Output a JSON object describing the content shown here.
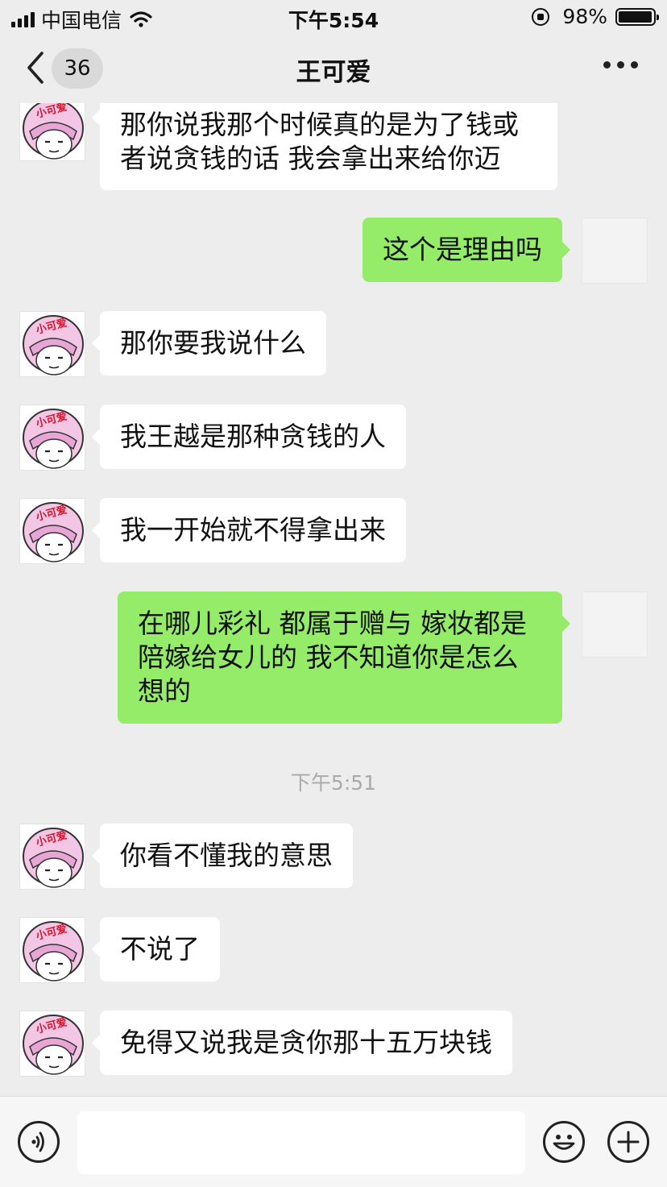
{
  "status_bar": {
    "carrier": "中国电信",
    "time": "下午5:54",
    "battery": "98%",
    "battery_level": 0.98
  },
  "header": {
    "back_count": "36",
    "title": "王可爱"
  },
  "avatar_text": "小可爱",
  "messages": [
    {
      "side": "in",
      "text": "那你说我那个时候真的是为了钱或\n者说贪钱的话 我会拿出来给你迈"
    },
    {
      "side": "out",
      "text": "这个是理由吗"
    },
    {
      "side": "in",
      "text": "那你要我说什么"
    },
    {
      "side": "in",
      "text": "我王越是那种贪钱的人"
    },
    {
      "side": "in",
      "text": "我一开始就不得拿出来"
    },
    {
      "side": "out",
      "text": "在哪儿彩礼 都属于赠与 嫁妆都是\n陪嫁给女儿的 我不知道你是怎么\n想的"
    },
    {
      "side": "time",
      "text": "下午5:51"
    },
    {
      "side": "in",
      "text": "你看不懂我的意思"
    },
    {
      "side": "in",
      "text": "不说了"
    },
    {
      "side": "in",
      "text": "免得又说我是贪你那十五万块钱"
    }
  ],
  "input_bar": {
    "icons": [
      "voice-icon",
      "emoji-icon",
      "plus-icon"
    ]
  },
  "colors": {
    "background": "#ededed",
    "outgoing_bubble": "#95ec69",
    "incoming_bubble": "#ffffff"
  }
}
